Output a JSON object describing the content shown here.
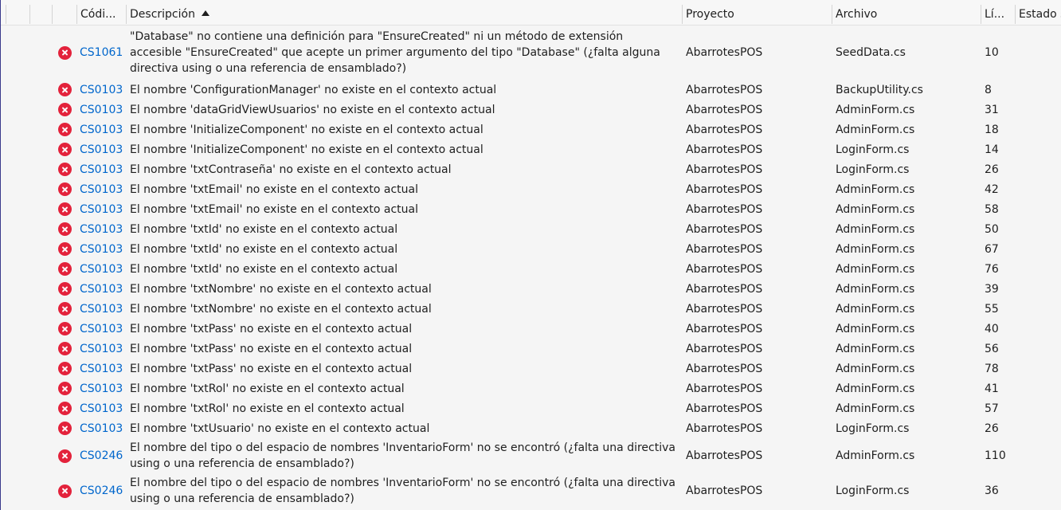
{
  "columns": {
    "code": "Códi...",
    "description": "Descripción",
    "project": "Proyecto",
    "file": "Archivo",
    "line": "Lí...",
    "state": "Estado s"
  },
  "rows": [
    {
      "code": "CS1061",
      "description": "\"Database\" no contiene una definición para \"EnsureCreated\" ni un método de extensión accesible \"EnsureCreated\" que acepte un primer argumento del tipo \"Database\" (¿falta alguna directiva using o una referencia de ensamblado?)",
      "project": "AbarrotesPOS",
      "file": "SeedData.cs",
      "line": "10"
    },
    {
      "code": "CS0103",
      "description": "El nombre 'ConfigurationManager' no existe en el contexto actual",
      "project": "AbarrotesPOS",
      "file": "BackupUtility.cs",
      "line": "8"
    },
    {
      "code": "CS0103",
      "description": "El nombre 'dataGridViewUsuarios' no existe en el contexto actual",
      "project": "AbarrotesPOS",
      "file": "AdminForm.cs",
      "line": "31"
    },
    {
      "code": "CS0103",
      "description": "El nombre 'InitializeComponent' no existe en el contexto actual",
      "project": "AbarrotesPOS",
      "file": "AdminForm.cs",
      "line": "18"
    },
    {
      "code": "CS0103",
      "description": "El nombre 'InitializeComponent' no existe en el contexto actual",
      "project": "AbarrotesPOS",
      "file": "LoginForm.cs",
      "line": "14"
    },
    {
      "code": "CS0103",
      "description": "El nombre 'txtContraseña' no existe en el contexto actual",
      "project": "AbarrotesPOS",
      "file": "LoginForm.cs",
      "line": "26"
    },
    {
      "code": "CS0103",
      "description": "El nombre 'txtEmail' no existe en el contexto actual",
      "project": "AbarrotesPOS",
      "file": "AdminForm.cs",
      "line": "42"
    },
    {
      "code": "CS0103",
      "description": "El nombre 'txtEmail' no existe en el contexto actual",
      "project": "AbarrotesPOS",
      "file": "AdminForm.cs",
      "line": "58"
    },
    {
      "code": "CS0103",
      "description": "El nombre 'txtId' no existe en el contexto actual",
      "project": "AbarrotesPOS",
      "file": "AdminForm.cs",
      "line": "50"
    },
    {
      "code": "CS0103",
      "description": "El nombre 'txtId' no existe en el contexto actual",
      "project": "AbarrotesPOS",
      "file": "AdminForm.cs",
      "line": "67"
    },
    {
      "code": "CS0103",
      "description": "El nombre 'txtId' no existe en el contexto actual",
      "project": "AbarrotesPOS",
      "file": "AdminForm.cs",
      "line": "76"
    },
    {
      "code": "CS0103",
      "description": "El nombre 'txtNombre' no existe en el contexto actual",
      "project": "AbarrotesPOS",
      "file": "AdminForm.cs",
      "line": "39"
    },
    {
      "code": "CS0103",
      "description": "El nombre 'txtNombre' no existe en el contexto actual",
      "project": "AbarrotesPOS",
      "file": "AdminForm.cs",
      "line": "55"
    },
    {
      "code": "CS0103",
      "description": "El nombre 'txtPass' no existe en el contexto actual",
      "project": "AbarrotesPOS",
      "file": "AdminForm.cs",
      "line": "40"
    },
    {
      "code": "CS0103",
      "description": "El nombre 'txtPass' no existe en el contexto actual",
      "project": "AbarrotesPOS",
      "file": "AdminForm.cs",
      "line": "56"
    },
    {
      "code": "CS0103",
      "description": "El nombre 'txtPass' no existe en el contexto actual",
      "project": "AbarrotesPOS",
      "file": "AdminForm.cs",
      "line": "78"
    },
    {
      "code": "CS0103",
      "description": "El nombre 'txtRol' no existe en el contexto actual",
      "project": "AbarrotesPOS",
      "file": "AdminForm.cs",
      "line": "41"
    },
    {
      "code": "CS0103",
      "description": "El nombre 'txtRol' no existe en el contexto actual",
      "project": "AbarrotesPOS",
      "file": "AdminForm.cs",
      "line": "57"
    },
    {
      "code": "CS0103",
      "description": "El nombre 'txtUsuario' no existe en el contexto actual",
      "project": "AbarrotesPOS",
      "file": "LoginForm.cs",
      "line": "26"
    },
    {
      "code": "CS0246",
      "description": "El nombre del tipo o del espacio de nombres 'InventarioForm' no se encontró (¿falta una directiva using o una referencia de ensamblado?)",
      "project": "AbarrotesPOS",
      "file": "AdminForm.cs",
      "line": "110"
    },
    {
      "code": "CS0246",
      "description": "El nombre del tipo o del espacio de nombres 'InventarioForm' no se encontró (¿falta una directiva using o una referencia de ensamblado?)",
      "project": "AbarrotesPOS",
      "file": "LoginForm.cs",
      "line": "36"
    }
  ],
  "icons": {
    "row_icon": "error-icon",
    "sort": "sort-ascending-icon"
  },
  "colors": {
    "error": "#e3223b",
    "link": "#0066cc",
    "background": "#f5f5f5"
  }
}
